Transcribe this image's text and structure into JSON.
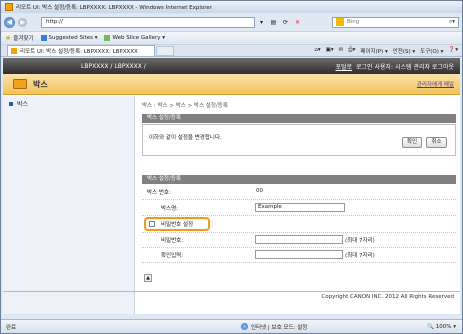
{
  "window": {
    "title": "리모트 UI: 박스 설정/등록: LBPXXXX: LBPXXXX - Windows Internet Explorer"
  },
  "addressbar": {
    "url": "http://",
    "search_placeholder": "Bing"
  },
  "favorites": {
    "label": "즐겨찾기",
    "items": [
      "Suggested Sites ▾",
      "Web Slice Gallery ▾"
    ]
  },
  "tab": {
    "label": "리모트 UI: 박스 설정/등록: LBPXXXX: LBPXXXX"
  },
  "commands": [
    "페이지(P) ▾",
    "안전(S) ▾",
    "도구(O) ▾",
    "❓▾"
  ],
  "header": {
    "model": "LBPXXXX / LBPXXXX /",
    "portal": "포털로",
    "logout_label": "로그인 사용자: 시스템 관리자 로그아웃"
  },
  "page": {
    "title": "박스",
    "admin_link": "관리자에게 메일"
  },
  "sidebar": {
    "items": [
      {
        "label": "박스"
      }
    ]
  },
  "breadcrumb": "박스 : 박스 > 박스 > 박스 설정/등록",
  "section1": {
    "header": "박스 설정/등록",
    "message": "이하와 같이 설정을 변경합니다.",
    "ok_label": "확인",
    "cancel_label": "취소"
  },
  "section2": {
    "header": "박스 설정/등록",
    "box_number_label": "박스 번호:",
    "box_number_value": "00",
    "box_name_label": "박스명:",
    "box_name_value": "Example",
    "password_checkbox_label": "비밀번호 설정",
    "password_label": "비밀번호:",
    "password_hint": "(최대 7자리)",
    "confirm_label": "확인입력:",
    "confirm_hint": "(최대 7자리)"
  },
  "footer": {
    "copyright": "Copyright CANON INC. 2012 All Rights Reserved"
  },
  "statusbar": {
    "status": "완료",
    "zone": "인터넷 | 보호 모드: 설정",
    "zoom": "100%"
  },
  "colors": {
    "header_dark": "#3a3a3a",
    "page_header_orange": "#f2c35e",
    "highlight": "#f39a1c"
  }
}
